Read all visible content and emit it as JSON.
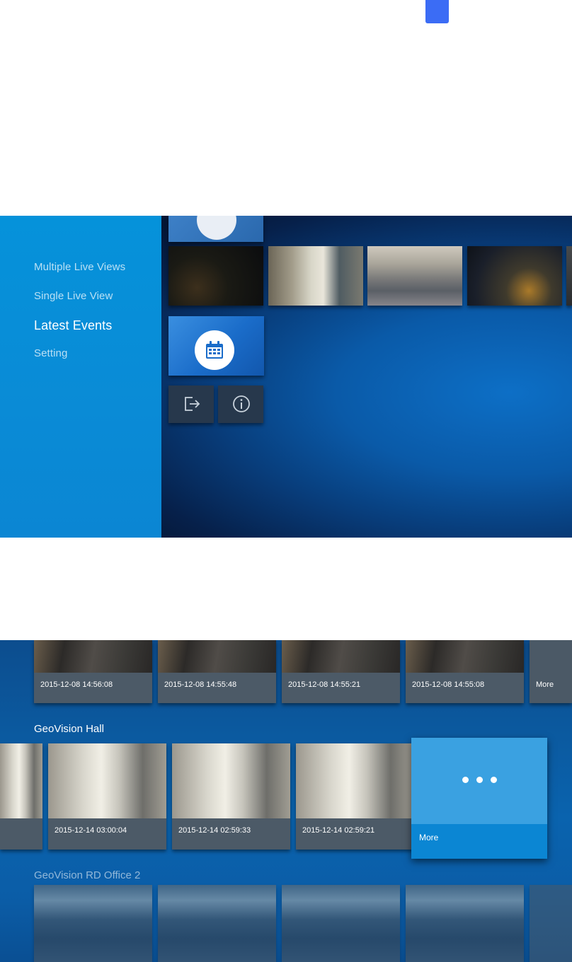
{
  "screen1": {
    "menu": [
      {
        "label": "Multiple Live Views",
        "active": false
      },
      {
        "label": "Single Live View",
        "active": false
      },
      {
        "label": "Latest Events",
        "active": true
      },
      {
        "label": "Setting",
        "active": false
      }
    ],
    "icons": {
      "events": "calendar-icon",
      "logout": "logout-icon",
      "info": "info-icon"
    }
  },
  "screen2": {
    "top_row": {
      "cards": [
        {
          "timestamp": "2015-12-08  14:56:08"
        },
        {
          "timestamp": "2015-12-08  14:55:48"
        },
        {
          "timestamp": "2015-12-08  14:55:21"
        },
        {
          "timestamp": "2015-12-08  14:55:08"
        },
        {
          "timestamp": "More"
        }
      ]
    },
    "hall_row": {
      "title": "GeoVision Hall",
      "cards": [
        {
          "timestamp": "2015-12-14  03:00:04"
        },
        {
          "timestamp": "2015-12-14  02:59:33"
        },
        {
          "timestamp": "2015-12-14  02:59:21"
        }
      ],
      "more_label": "More"
    },
    "office_row": {
      "title": "GeoVision RD Office 2"
    }
  },
  "colors": {
    "sidebar": "#0592da",
    "more_card": "#3aa1e1",
    "caption_bg": "#4c5a67",
    "marker": "#3b6cf5"
  }
}
